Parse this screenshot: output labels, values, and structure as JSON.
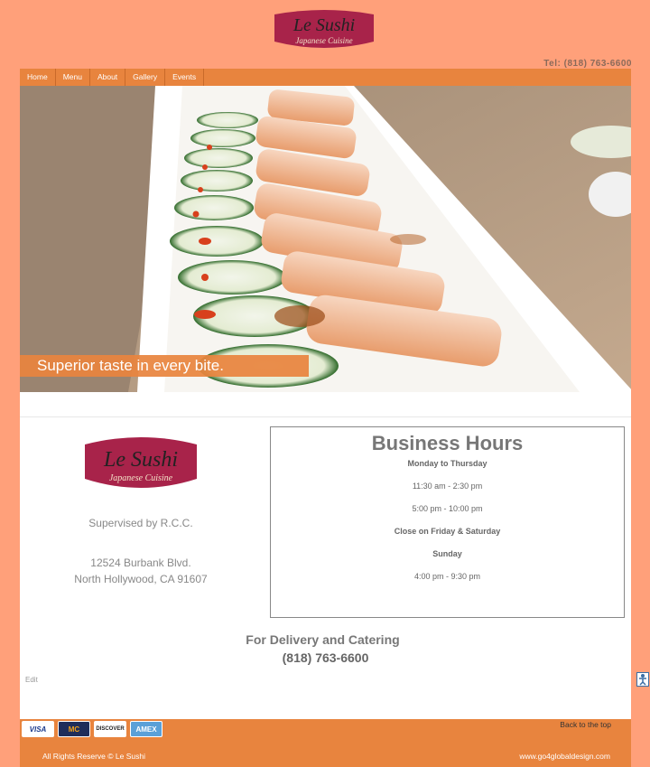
{
  "header": {
    "logo_title": "Le Sushi",
    "logo_subtitle": "Japanese Cuisine",
    "tel": "Tel: (818) 763-6600"
  },
  "nav": {
    "items": [
      "Home",
      "Menu",
      "About",
      "Gallery",
      "Events"
    ]
  },
  "hero": {
    "tagline": "Superior taste in every bite."
  },
  "info": {
    "logo_title": "Le Sushi",
    "logo_subtitle": "Japanese Cuisine",
    "supervised": "Supervised by R.C.C.",
    "address_line1": "12524 Burbank Blvd.",
    "address_line2": "North Hollywood, CA 91607"
  },
  "hours": {
    "title": "Business Hours",
    "mon_thu": "Monday to Thursday",
    "slot1": "11:30 am - 2:30 pm",
    "slot2": "5:00 pm - 10:00 pm",
    "closed": "Close on Friday & Saturday",
    "sunday": "Sunday",
    "sunday_slot": "4:00 pm - 9:30 pm"
  },
  "delivery": {
    "label": "For Delivery and Catering",
    "phone": "(818) 763-6600"
  },
  "edit_label": "Edit",
  "footer": {
    "cards": [
      "VISA",
      "MC",
      "DISCOVER",
      "AMEX"
    ],
    "back_to_top": "Back to the top",
    "copyright": "All Rights Reserve © Le Sushi",
    "designer": "www.go4globaldesign.com"
  },
  "colors": {
    "background": "#FFA07A",
    "accent": "#E8843E",
    "logo": "#A8234A"
  }
}
